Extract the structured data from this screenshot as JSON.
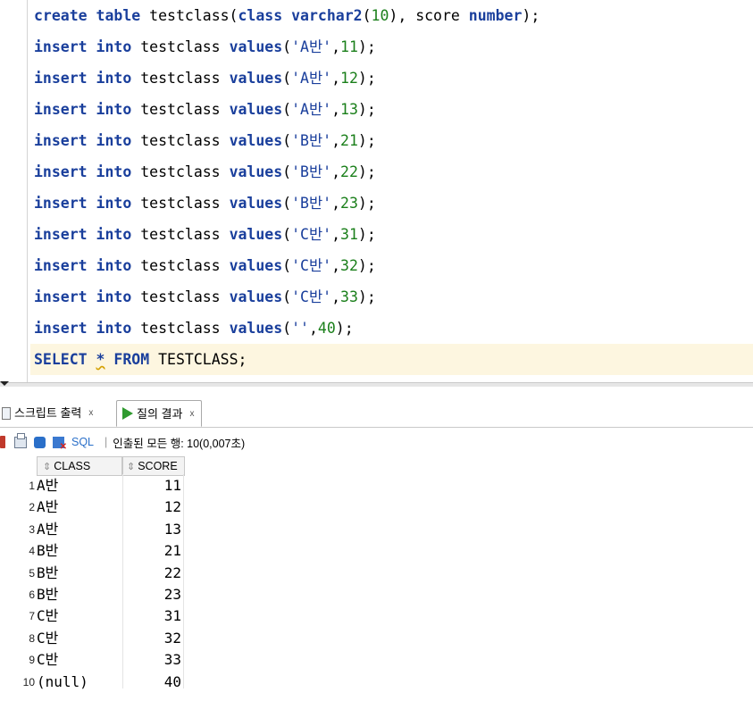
{
  "editor": {
    "lines": [
      [
        {
          "t": "create table",
          "c": "kw"
        },
        {
          "t": " testclass(",
          "c": "plain"
        },
        {
          "t": "class varchar2",
          "c": "kw"
        },
        {
          "t": "(",
          "c": "plain"
        },
        {
          "t": "10",
          "c": "num"
        },
        {
          "t": "), score ",
          "c": "plain"
        },
        {
          "t": "number",
          "c": "kw"
        },
        {
          "t": ");",
          "c": "plain"
        }
      ],
      [
        {
          "t": "insert into",
          "c": "kw"
        },
        {
          "t": " testclass ",
          "c": "plain"
        },
        {
          "t": "values",
          "c": "kw"
        },
        {
          "t": "(",
          "c": "plain"
        },
        {
          "t": "'A반'",
          "c": "str"
        },
        {
          "t": ",",
          "c": "plain"
        },
        {
          "t": "11",
          "c": "num"
        },
        {
          "t": ");",
          "c": "plain"
        }
      ],
      [
        {
          "t": "insert into",
          "c": "kw"
        },
        {
          "t": " testclass ",
          "c": "plain"
        },
        {
          "t": "values",
          "c": "kw"
        },
        {
          "t": "(",
          "c": "plain"
        },
        {
          "t": "'A반'",
          "c": "str"
        },
        {
          "t": ",",
          "c": "plain"
        },
        {
          "t": "12",
          "c": "num"
        },
        {
          "t": ");",
          "c": "plain"
        }
      ],
      [
        {
          "t": "insert into",
          "c": "kw"
        },
        {
          "t": " testclass ",
          "c": "plain"
        },
        {
          "t": "values",
          "c": "kw"
        },
        {
          "t": "(",
          "c": "plain"
        },
        {
          "t": "'A반'",
          "c": "str"
        },
        {
          "t": ",",
          "c": "plain"
        },
        {
          "t": "13",
          "c": "num"
        },
        {
          "t": ");",
          "c": "plain"
        }
      ],
      [
        {
          "t": "insert into",
          "c": "kw"
        },
        {
          "t": " testclass ",
          "c": "plain"
        },
        {
          "t": "values",
          "c": "kw"
        },
        {
          "t": "(",
          "c": "plain"
        },
        {
          "t": "'B반'",
          "c": "str"
        },
        {
          "t": ",",
          "c": "plain"
        },
        {
          "t": "21",
          "c": "num"
        },
        {
          "t": ");",
          "c": "plain"
        }
      ],
      [
        {
          "t": "insert into",
          "c": "kw"
        },
        {
          "t": " testclass ",
          "c": "plain"
        },
        {
          "t": "values",
          "c": "kw"
        },
        {
          "t": "(",
          "c": "plain"
        },
        {
          "t": "'B반'",
          "c": "str"
        },
        {
          "t": ",",
          "c": "plain"
        },
        {
          "t": "22",
          "c": "num"
        },
        {
          "t": ");",
          "c": "plain"
        }
      ],
      [
        {
          "t": "insert into",
          "c": "kw"
        },
        {
          "t": " testclass ",
          "c": "plain"
        },
        {
          "t": "values",
          "c": "kw"
        },
        {
          "t": "(",
          "c": "plain"
        },
        {
          "t": "'B반'",
          "c": "str"
        },
        {
          "t": ",",
          "c": "plain"
        },
        {
          "t": "23",
          "c": "num"
        },
        {
          "t": ");",
          "c": "plain"
        }
      ],
      [
        {
          "t": "insert into",
          "c": "kw"
        },
        {
          "t": " testclass ",
          "c": "plain"
        },
        {
          "t": "values",
          "c": "kw"
        },
        {
          "t": "(",
          "c": "plain"
        },
        {
          "t": "'C반'",
          "c": "str"
        },
        {
          "t": ",",
          "c": "plain"
        },
        {
          "t": "31",
          "c": "num"
        },
        {
          "t": ");",
          "c": "plain"
        }
      ],
      [
        {
          "t": "insert into",
          "c": "kw"
        },
        {
          "t": " testclass ",
          "c": "plain"
        },
        {
          "t": "values",
          "c": "kw"
        },
        {
          "t": "(",
          "c": "plain"
        },
        {
          "t": "'C반'",
          "c": "str"
        },
        {
          "t": ",",
          "c": "plain"
        },
        {
          "t": "32",
          "c": "num"
        },
        {
          "t": ");",
          "c": "plain"
        }
      ],
      [
        {
          "t": "insert into",
          "c": "kw"
        },
        {
          "t": " testclass ",
          "c": "plain"
        },
        {
          "t": "values",
          "c": "kw"
        },
        {
          "t": "(",
          "c": "plain"
        },
        {
          "t": "'C반'",
          "c": "str"
        },
        {
          "t": ",",
          "c": "plain"
        },
        {
          "t": "33",
          "c": "num"
        },
        {
          "t": ");",
          "c": "plain"
        }
      ],
      [
        {
          "t": "insert into",
          "c": "kw"
        },
        {
          "t": " testclass ",
          "c": "plain"
        },
        {
          "t": "values",
          "c": "kw"
        },
        {
          "t": "(",
          "c": "plain"
        },
        {
          "t": "''",
          "c": "str"
        },
        {
          "t": ",",
          "c": "plain"
        },
        {
          "t": "40",
          "c": "num"
        },
        {
          "t": ");",
          "c": "plain"
        }
      ],
      [
        {
          "t": "SELECT",
          "c": "kw"
        },
        {
          "t": " ",
          "c": "plain"
        },
        {
          "t": "*",
          "c": "kw sq"
        },
        {
          "t": " ",
          "c": "plain"
        },
        {
          "t": "FROM",
          "c": "kw"
        },
        {
          "t": " TESTCLASS;",
          "c": "plain"
        }
      ]
    ],
    "current_line_index": 11
  },
  "tabs": {
    "script_output": "스크립트 출력",
    "query_result": "질의 결과",
    "close": "x"
  },
  "toolbar": {
    "sql_label": "SQL",
    "separator": "|",
    "status": "인출된 모든 행: 10(0,007초)"
  },
  "grid": {
    "columns": [
      "CLASS",
      "SCORE"
    ],
    "sort_glyph": "⇕",
    "rows": [
      {
        "n": "1",
        "class": "A반",
        "score": "11"
      },
      {
        "n": "2",
        "class": "A반",
        "score": "12"
      },
      {
        "n": "3",
        "class": "A반",
        "score": "13"
      },
      {
        "n": "4",
        "class": "B반",
        "score": "21"
      },
      {
        "n": "5",
        "class": "B반",
        "score": "22"
      },
      {
        "n": "6",
        "class": "B반",
        "score": "23"
      },
      {
        "n": "7",
        "class": "C반",
        "score": "31"
      },
      {
        "n": "8",
        "class": "C반",
        "score": "32"
      },
      {
        "n": "9",
        "class": "C반",
        "score": "33"
      },
      {
        "n": "10",
        "class": "(null)",
        "score": "40"
      }
    ]
  },
  "colors": {
    "keyword": "#1a3f9c",
    "number": "#1a7f1a",
    "current_line_bg": "#fdf6e0",
    "run_icon": "#2f9a2f"
  }
}
